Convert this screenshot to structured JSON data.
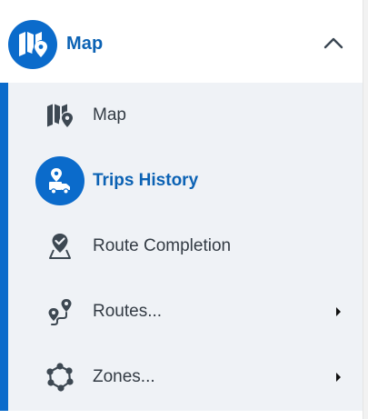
{
  "section": {
    "label": "Map",
    "icon": "map-pin-icon",
    "expanded": true,
    "accent_color": "#0b6bcb"
  },
  "items": [
    {
      "label": "Map",
      "icon": "map-icon",
      "selected": false,
      "has_submenu": false
    },
    {
      "label": "Trips History",
      "icon": "trips-history-icon",
      "selected": true,
      "has_submenu": false
    },
    {
      "label": "Route Completion",
      "icon": "route-completion-icon",
      "selected": false,
      "has_submenu": false
    },
    {
      "label": "Routes...",
      "icon": "routes-icon",
      "selected": false,
      "has_submenu": true
    },
    {
      "label": "Zones...",
      "icon": "zones-icon",
      "selected": false,
      "has_submenu": true
    }
  ]
}
